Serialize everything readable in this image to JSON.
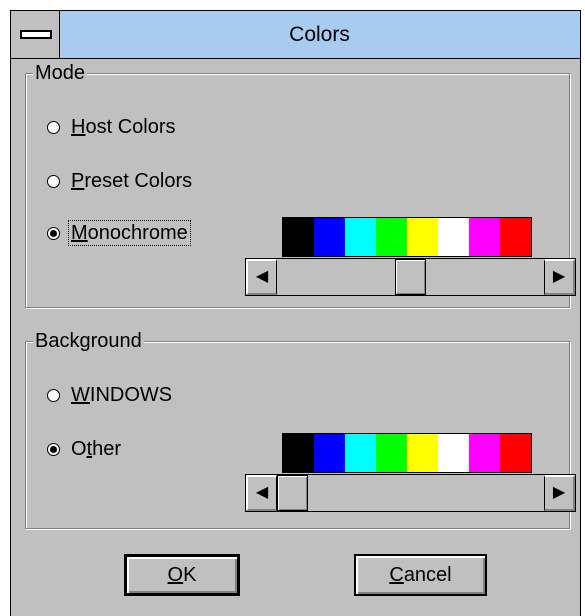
{
  "window": {
    "title": "Colors"
  },
  "mode": {
    "label": "Mode",
    "options": [
      {
        "label": "Host Colors",
        "checked": false
      },
      {
        "label": "Preset Colors",
        "checked": false
      },
      {
        "label": "Monochrome",
        "checked": true
      }
    ],
    "scroll_position": 0.5
  },
  "background": {
    "label": "Background",
    "options": [
      {
        "label": "WINDOWS",
        "checked": false
      },
      {
        "label": "Other",
        "checked": true
      }
    ],
    "scroll_position": 0.0
  },
  "palette_colors": [
    "#000000",
    "#0000ff",
    "#00ffff",
    "#00ff00",
    "#ffff00",
    "#ffffff",
    "#ff00ff",
    "#ff0000"
  ],
  "buttons": {
    "ok": "OK",
    "cancel": "Cancel"
  },
  "icons": {
    "scroll_left": "left-arrow-icon",
    "scroll_right": "right-arrow-icon",
    "system_menu": "system-menu-icon"
  }
}
